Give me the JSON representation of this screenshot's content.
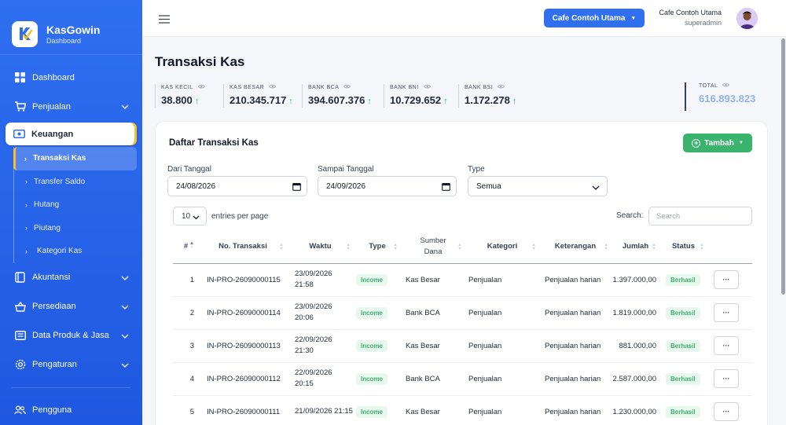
{
  "brand": {
    "name": "KasGowin",
    "subtitle": "Dashboard"
  },
  "sidebar": {
    "items": [
      {
        "label": "Dashboard",
        "icon": "grid-icon"
      },
      {
        "label": "Penjualan",
        "icon": "cart-icon",
        "expandable": true
      },
      {
        "label": "Keuangan",
        "icon": "cash-icon",
        "active": true
      },
      {
        "label": "Akuntansi",
        "icon": "book-icon",
        "expandable": true
      },
      {
        "label": "Persediaan",
        "icon": "basket-icon",
        "expandable": true
      },
      {
        "label": "Data Produk & Jasa",
        "icon": "list-icon",
        "expandable": true
      },
      {
        "label": "Pengaturan",
        "icon": "gear-icon",
        "expandable": true
      },
      {
        "label": "Pengguna",
        "icon": "users-icon"
      }
    ],
    "subitems": [
      {
        "label": "Transaksi Kas",
        "active": true
      },
      {
        "label": "Transfer Saldo"
      },
      {
        "label": "Hutang"
      },
      {
        "label": "Piutang"
      },
      {
        "label": "Kategori Kas"
      }
    ],
    "colors": {
      "bg_top": "#2f6ff0",
      "bg_bottom": "#1f58e0",
      "active_marker": "#fbbf24"
    }
  },
  "topbar": {
    "outlet_label": "Cafe Contoh Utama",
    "user_name": "Cafe Contoh Utama",
    "user_role": "superadmin"
  },
  "page": {
    "title": "Transaksi Kas",
    "stats": [
      {
        "label": "KAS KECIL",
        "value": "38.800"
      },
      {
        "label": "KAS BESAR",
        "value": "210.345.717"
      },
      {
        "label": "BANK BCA",
        "value": "394.607.376"
      },
      {
        "label": "BANK BNI",
        "value": "10.729.652"
      },
      {
        "label": "BANK BSI",
        "value": "1.172.278"
      }
    ],
    "total": {
      "label": "TOTAL",
      "value": "616.893.823"
    }
  },
  "card": {
    "title": "Daftar Transaksi Kas",
    "add_label": "Tambah",
    "filters": {
      "from_label": "Dari Tanggal",
      "from_value": "24/08/2026",
      "to_label": "Sampai Tanggal",
      "to_value": "24/09/2026",
      "type_label": "Type",
      "type_value": "Semua"
    },
    "entries_value": "10",
    "entries_label": "entries per page",
    "search_label": "Search:",
    "search_placeholder": "Search"
  },
  "table": {
    "headers": [
      "#",
      "No. Transaksi",
      "Waktu",
      "Type",
      "Sumber Dana",
      "Kategori",
      "Keterangan",
      "Jumlah",
      "Status"
    ],
    "rows": [
      {
        "no": "1",
        "id": "IN-PRO-26090000115",
        "date": "23/09/2026",
        "time": "21:58",
        "type": "Income",
        "source": "Kas Besar",
        "category": "Penjualan",
        "note": "Penjualan harian",
        "amount": "1.397.000,00",
        "status": "Berhasil"
      },
      {
        "no": "2",
        "id": "IN-PRO-26090000114",
        "date": "23/09/2026",
        "time": "20:06",
        "type": "Income",
        "source": "Bank BCA",
        "category": "Penjualan",
        "note": "Penjualan harian",
        "amount": "1.819.000,00",
        "status": "Berhasil"
      },
      {
        "no": "3",
        "id": "IN-PRO-26090000113",
        "date": "22/09/2026",
        "time": "21:30",
        "type": "Income",
        "source": "Kas Besar",
        "category": "Penjualan",
        "note": "Penjualan harian",
        "amount": "881.000,00",
        "status": "Berhasil"
      },
      {
        "no": "4",
        "id": "IN-PRO-26090000112",
        "date": "22/09/2026",
        "time": "20:15",
        "type": "Income",
        "source": "Bank BCA",
        "category": "Penjualan",
        "note": "Penjualan harian",
        "amount": "2.587.000,00",
        "status": "Berhasil"
      },
      {
        "no": "5",
        "id": "IN-PRO-26090000111",
        "date": "21/09/2026 21:15",
        "time": "",
        "type": "Income",
        "source": "Kas Besar",
        "category": "Penjualan",
        "note": "Penjualan harian",
        "amount": "1.230.000,00",
        "status": "Berhasil"
      }
    ],
    "action_label": "···"
  }
}
